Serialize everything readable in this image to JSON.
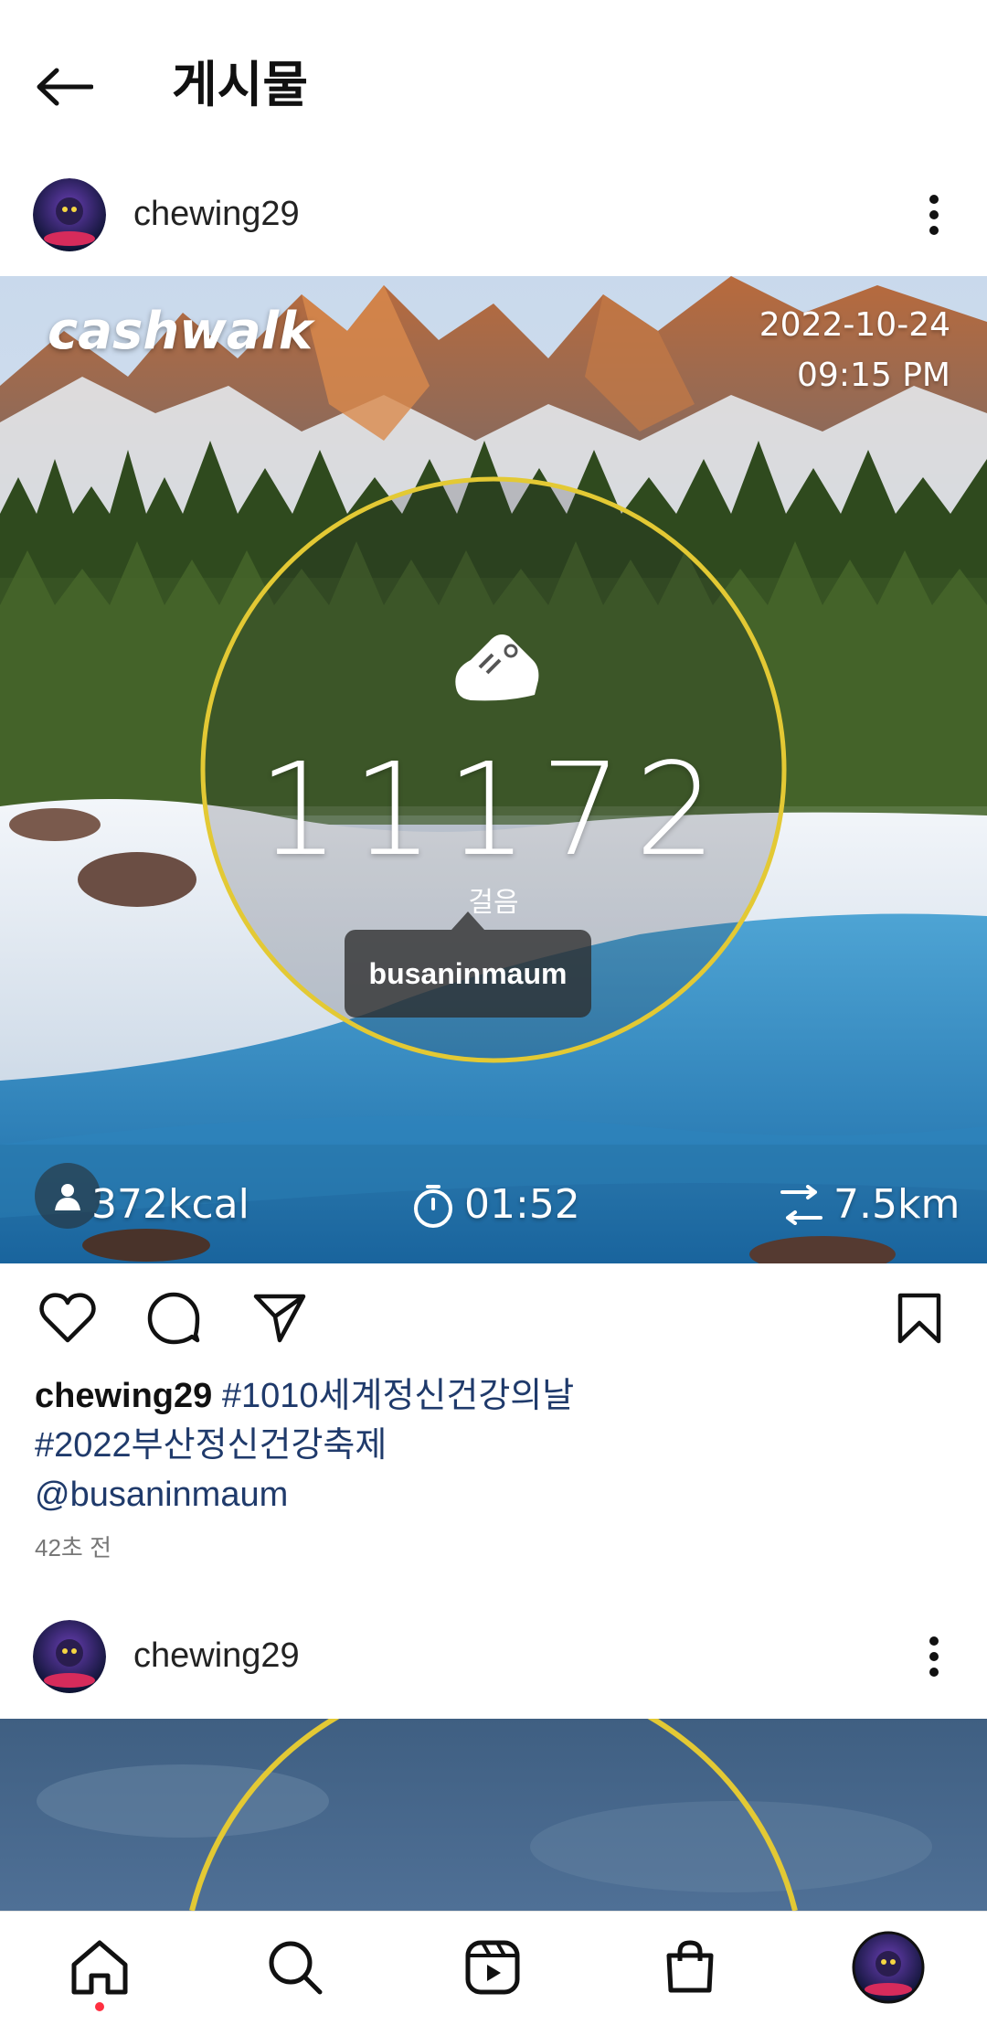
{
  "header": {
    "title": "게시물",
    "back_icon": "arrow-left-icon"
  },
  "post1": {
    "username": "chewing29",
    "image": {
      "brand": "cashwalk",
      "date": "2022-10-24",
      "time": "09:15 PM",
      "steps": "11172",
      "steps_label": "걸음",
      "tag_user": "busaninmaum",
      "calories": "372kcal",
      "duration": "01:52",
      "distance": "7.5km"
    },
    "caption": {
      "user": "chewing29",
      "line1_tag": "#1010세계정신건강의날",
      "line2_tag": "#2022부산정신건강축제",
      "line3_mention": "@busaninmaum"
    },
    "timestamp": "42초 전"
  },
  "post2": {
    "username": "chewing29"
  },
  "colors": {
    "ring": "#e3c934",
    "nav_dot": "#ff3040",
    "link": "#1f3a6b"
  },
  "bottom_nav": [
    "home-icon",
    "search-icon",
    "reels-icon",
    "shop-icon",
    "profile-avatar"
  ]
}
